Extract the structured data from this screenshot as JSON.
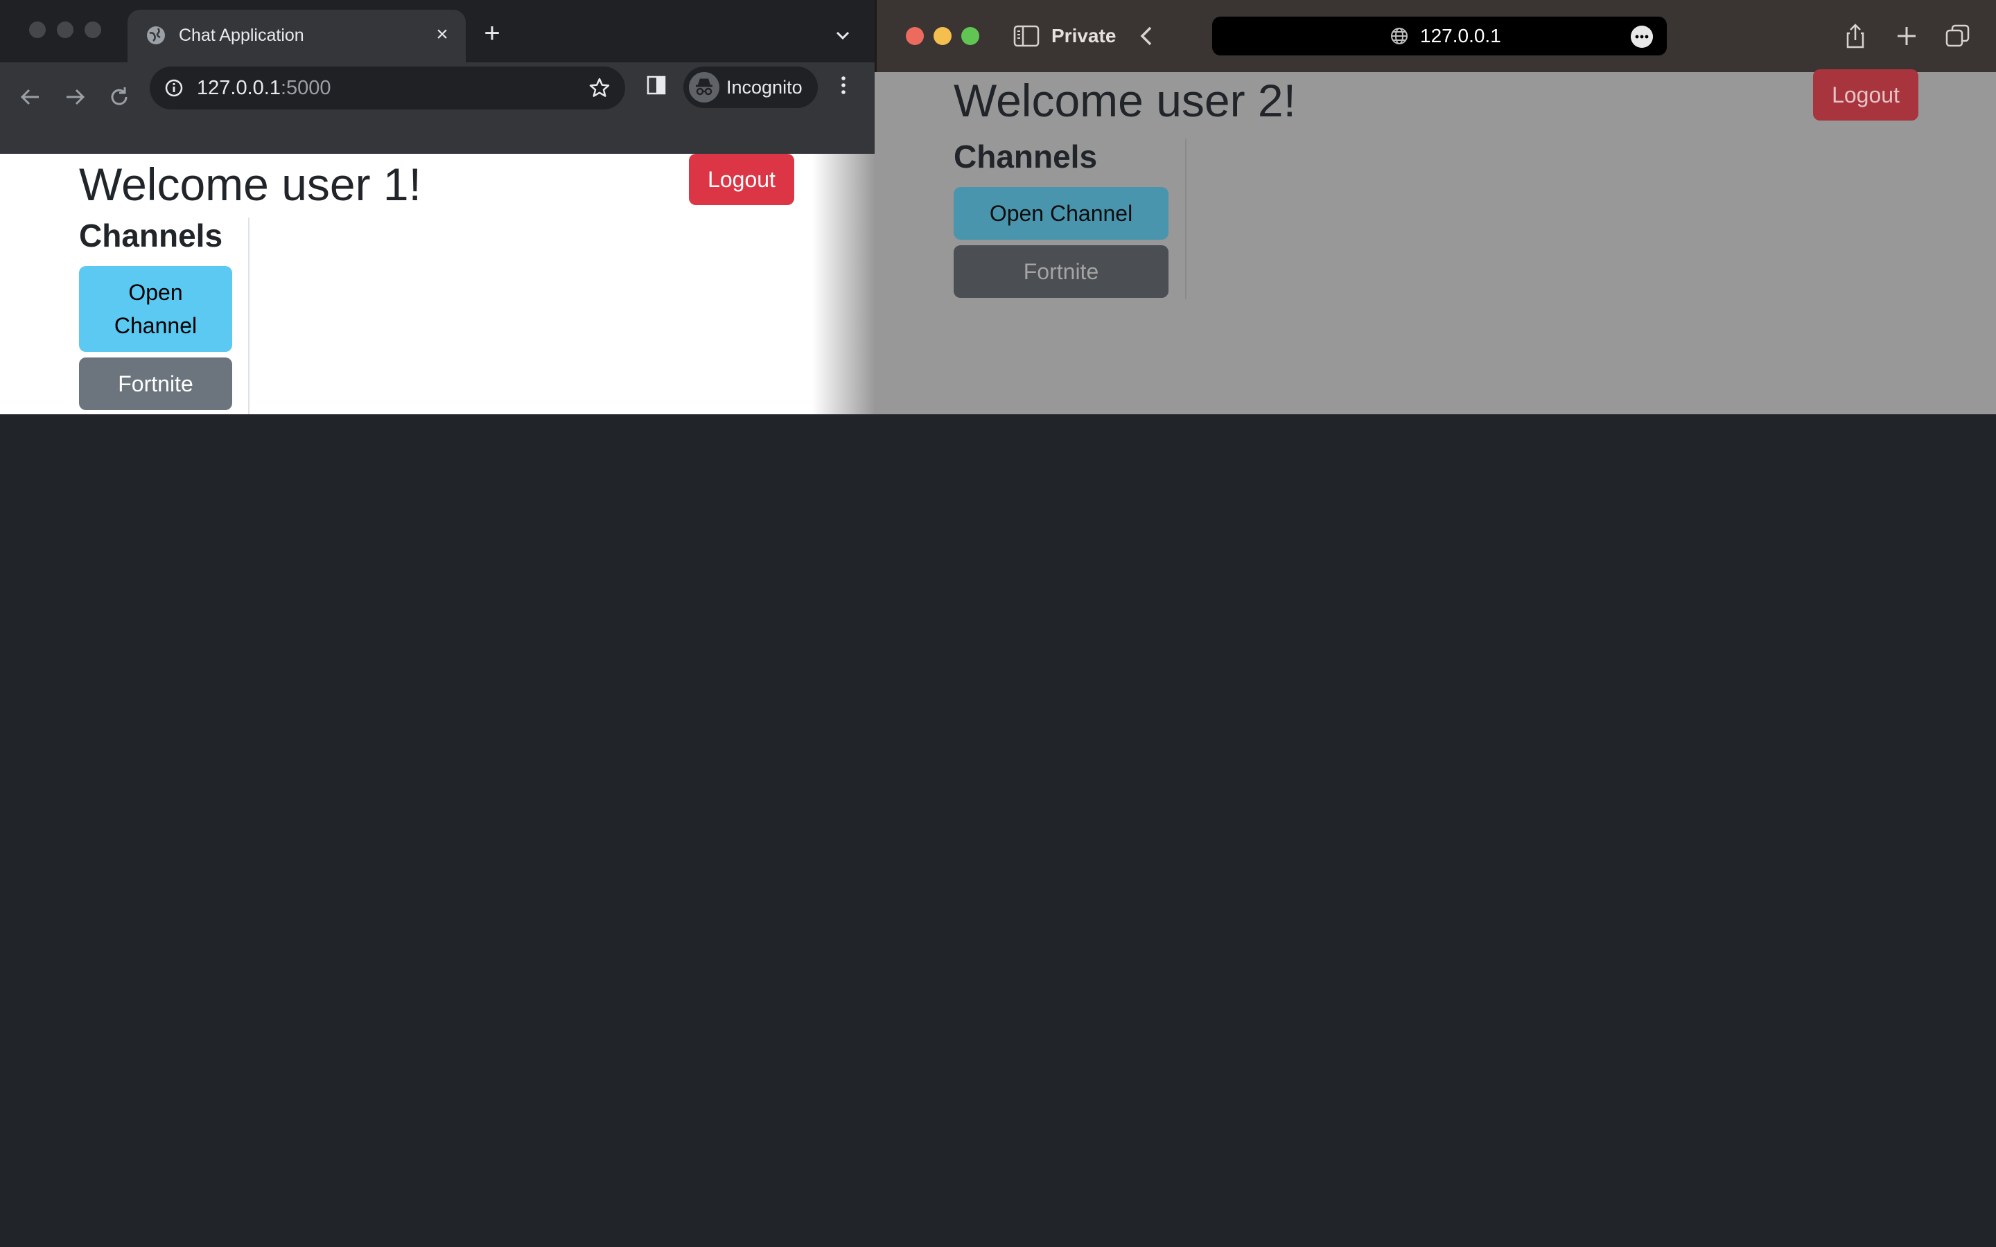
{
  "chrome": {
    "tab_title": "Chat Application",
    "close_glyph": "×",
    "new_tab_glyph": "+",
    "url_host": "127.0.0.1",
    "url_port": ":5000",
    "incognito_label": "Incognito",
    "icons": [
      "globe-icon",
      "close-icon",
      "plus-icon",
      "chevron-down-icon",
      "back-arrow-icon",
      "forward-arrow-icon",
      "reload-icon",
      "info-icon",
      "star-icon",
      "side-panel-icon",
      "incognito-icon",
      "kebab-menu-icon"
    ]
  },
  "user1_app": {
    "welcome": "Welcome user 1!",
    "logout": "Logout",
    "channels_heading": "Channels",
    "channels": [
      {
        "label": "Open Channel"
      },
      {
        "label": "Fortnite"
      }
    ]
  },
  "safari": {
    "private_label": "Private",
    "url": "127.0.0.1",
    "icons": [
      "close-light-icon",
      "minimize-light-icon",
      "zoom-light-icon",
      "sidebar-icon",
      "back-chevron-icon",
      "globe-icon",
      "more-icon",
      "share-icon",
      "plus-icon",
      "tabs-overview-icon"
    ]
  },
  "user2_app": {
    "welcome": "Welcome user 2!",
    "logout": "Logout",
    "channels_heading": "Channels",
    "channels": [
      {
        "label": "Open Channel"
      },
      {
        "label": "Fortnite"
      }
    ]
  },
  "colors": {
    "logout": "#dc3545",
    "open_channel": "#5bc9f1",
    "fortnite": "#6c757d",
    "desktop": "#212428",
    "safari_overlay": "#989898"
  }
}
